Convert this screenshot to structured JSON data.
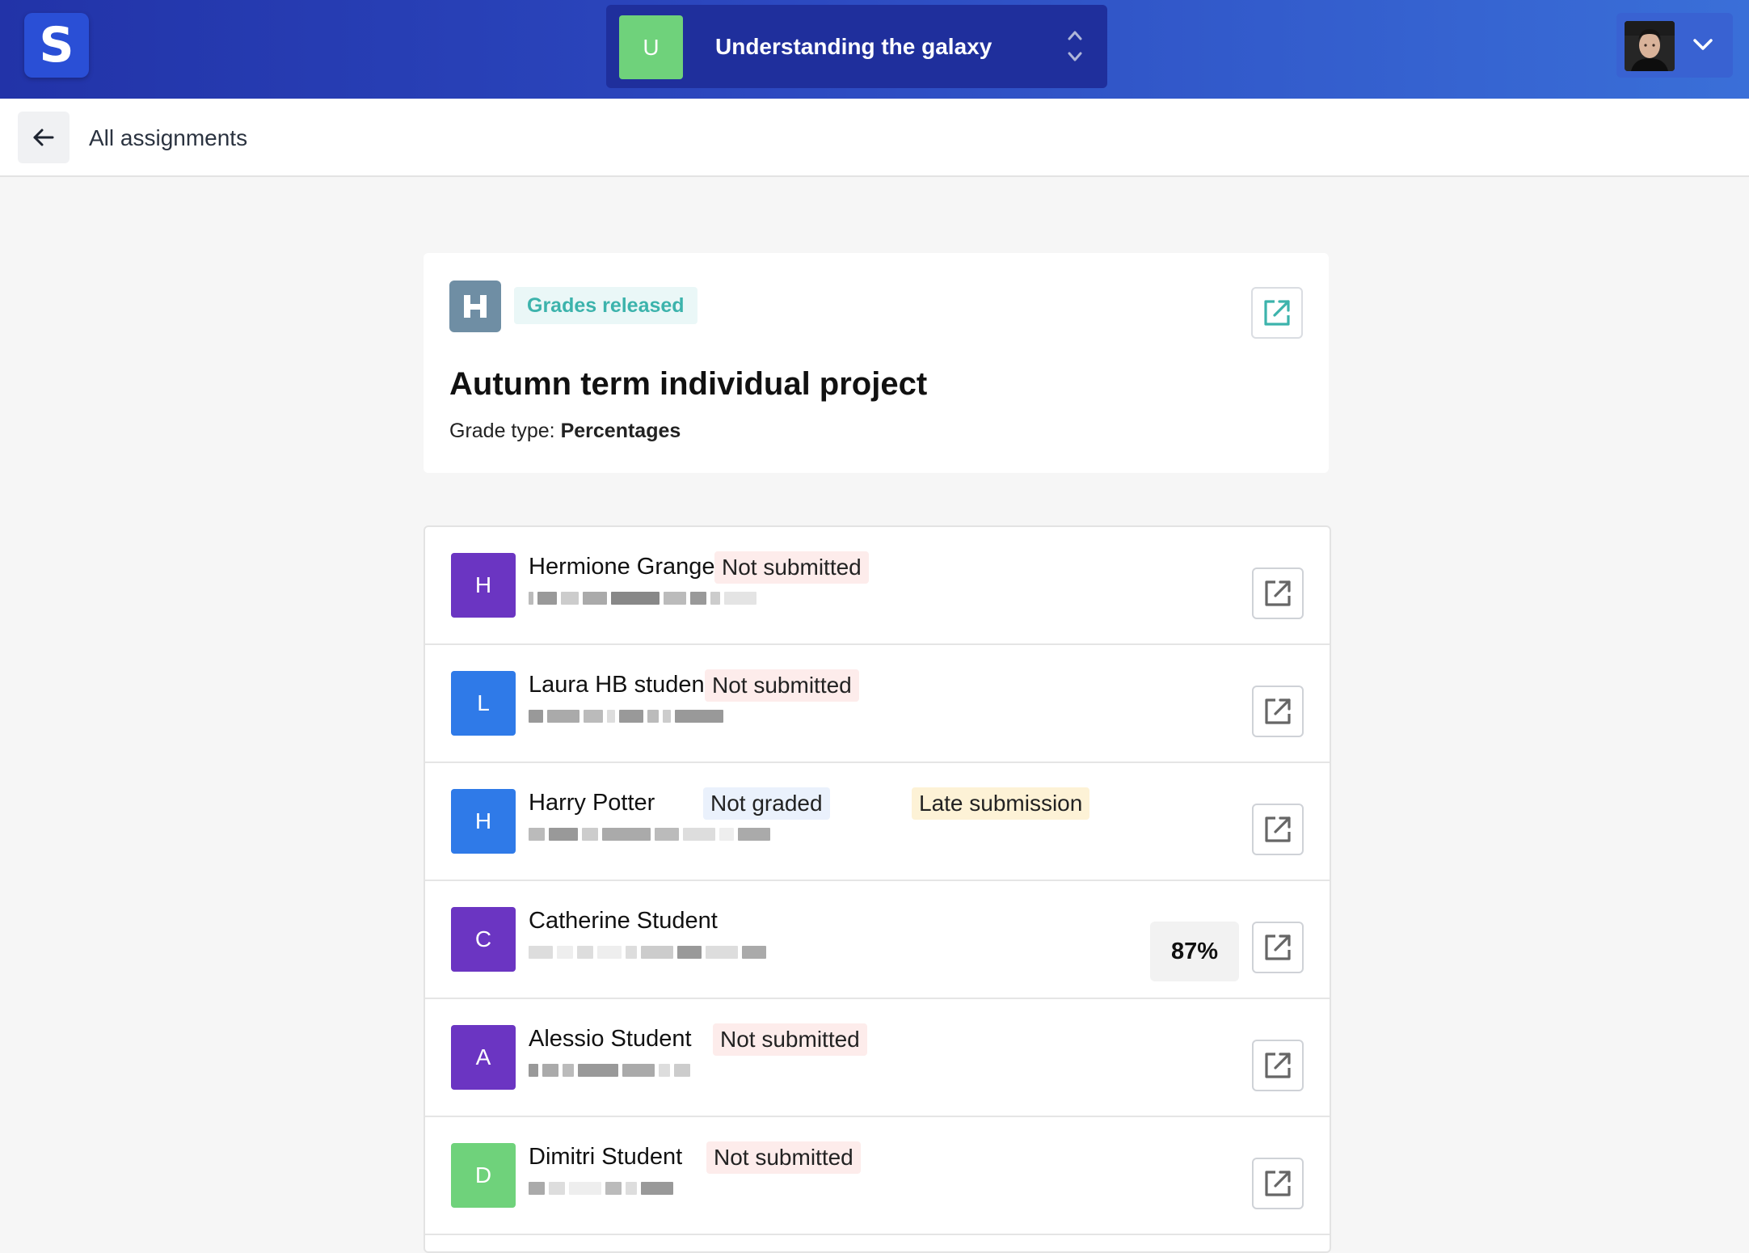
{
  "header": {
    "logo_letter": "S",
    "class_avatar_letter": "U",
    "class_name": "Understanding the galaxy",
    "class_avatar_color": "#6fd27b"
  },
  "breadcrumb": {
    "label": "All assignments"
  },
  "assignment": {
    "status": "Grades released",
    "title": "Autumn term individual project",
    "grade_type_label": "Grade type:",
    "grade_type_value": "Percentages"
  },
  "students": [
    {
      "initial": "H",
      "name": "Hermione Granger",
      "avatar_color": "#6b35c2",
      "badges": [
        {
          "text": "Not submitted",
          "kind": "red"
        }
      ],
      "grade": ""
    },
    {
      "initial": "L",
      "name": "Laura HB student",
      "avatar_color": "#2f7ae8",
      "badges": [
        {
          "text": "Not submitted",
          "kind": "red"
        }
      ],
      "grade": ""
    },
    {
      "initial": "H",
      "name": "Harry Potter",
      "avatar_color": "#2f7ae8",
      "badges": [
        {
          "text": "Not graded",
          "kind": "blue"
        },
        {
          "text": "Late submission",
          "kind": "yellow"
        }
      ],
      "grade": ""
    },
    {
      "initial": "C",
      "name": "Catherine Student",
      "avatar_color": "#6b35c2",
      "badges": [],
      "grade": "87%"
    },
    {
      "initial": "A",
      "name": "Alessio Student",
      "avatar_color": "#6b35c2",
      "badges": [
        {
          "text": "Not submitted",
          "kind": "red"
        }
      ],
      "grade": ""
    },
    {
      "initial": "D",
      "name": "Dimitri Student",
      "avatar_color": "#6fd27b",
      "badges": [
        {
          "text": "Not submitted",
          "kind": "red"
        }
      ],
      "grade": ""
    }
  ],
  "icons": {
    "back": "arrow-left-icon",
    "switcher": "chevron-up-down-icon",
    "user_menu": "chevron-down-icon",
    "open": "external-link-icon"
  },
  "colors": {
    "topbar": "#2233a8",
    "status_text": "#3cb3ac",
    "status_bg": "#eaf7f7"
  }
}
